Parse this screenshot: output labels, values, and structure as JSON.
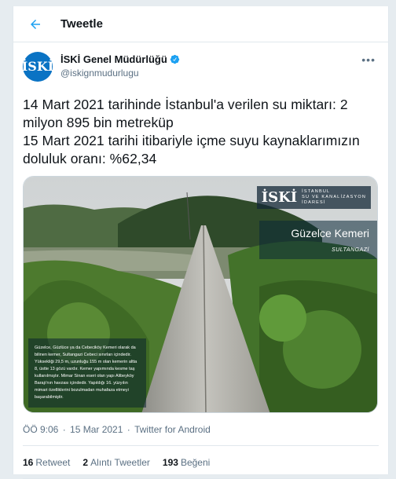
{
  "header": {
    "title": "Tweetle"
  },
  "author": {
    "name": "İSKİ Genel Müdürlüğü",
    "handle": "@iskignmudurlugu",
    "avatar_label": "İSKİ"
  },
  "tweet": {
    "text": "14 Mart 2021 tarihinde İstanbul'a verilen su miktarı: 2 milyon 895 bin metreküp\n15 Mart 2021 tarihi itibariyle içme suyu kaynaklarımızın doluluk oranı: %62,34",
    "time": "ÖÖ 9:06",
    "date": "15 Mar 2021",
    "source": "Twitter for Android"
  },
  "media": {
    "logo_mark": "İSKİ",
    "logo_lines": [
      "İSTANBUL",
      "SU VE KANALİZASYON",
      "İDARESİ"
    ],
    "place_name": "Güzelce Kemeri",
    "place_sub": "SULTANGAZİ",
    "description": "Güzelce, Güzlüce ya da Cebeciköy Kemeri olarak da bilinen kemer, Sultangazi Cebeci sınırları içindedir. Yüksekliği 29,5 m, uzunluğu 155 m olan kemerin altta 8, üstte 13 gözü vardır. Kemer yapımında kesme taş kullanılmıştır. Mimar Sinan eseri olan yapı Alibeyköy Barajı'nın havzası içindedir. Yapıldığı 16. yüzyılın mimari özelliklerini bozulmadan muhafaza etmeyi başarabilmiştir."
  },
  "stats": {
    "retweets_count": "16",
    "retweets_label": "Retweet",
    "quotes_count": "2",
    "quotes_label": "Alıntı Tweetler",
    "likes_count": "193",
    "likes_label": "Beğeni"
  },
  "colors": {
    "accent": "#1da1f2",
    "verified": "#1da1f2",
    "avatar": "#0a73c4"
  }
}
